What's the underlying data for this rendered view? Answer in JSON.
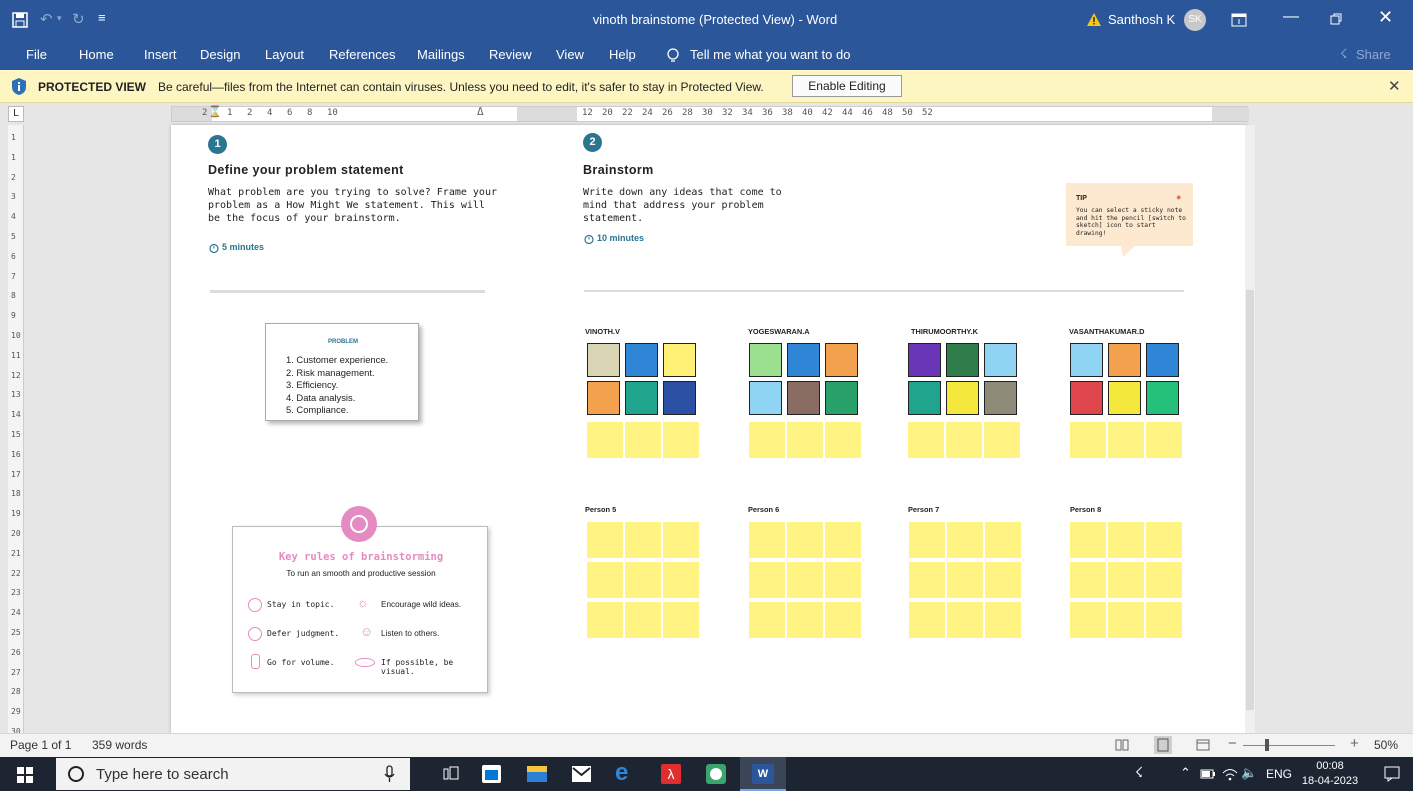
{
  "window": {
    "title": "vinoth brainstome (Protected View) - Word",
    "user": "Santhosh K",
    "user_initials": "SK"
  },
  "ribbon": {
    "tabs": [
      "File",
      "Home",
      "Insert",
      "Design",
      "Layout",
      "References",
      "Mailings",
      "Review",
      "View",
      "Help"
    ],
    "tell_me": "Tell me what you want to do",
    "share": "Share"
  },
  "protected_view": {
    "label": "PROTECTED VIEW",
    "message": "Be careful—files from the Internet can contain viruses. Unless you need to edit, it's safer to stay in Protected View.",
    "button": "Enable Editing"
  },
  "ruler": {
    "corner": "L",
    "numbers": [
      "2",
      "1",
      "2",
      "4",
      "6",
      "8",
      "10",
      "12",
      "20",
      "22",
      "24",
      "26",
      "28",
      "30",
      "32",
      "34",
      "36",
      "38",
      "40",
      "42",
      "44",
      "46",
      "48",
      "50",
      "52"
    ],
    "vnumbers": [
      "1",
      "1",
      "2",
      "3",
      "4",
      "5",
      "6",
      "7",
      "8",
      "9",
      "10",
      "11",
      "12",
      "13",
      "14",
      "15",
      "16",
      "17",
      "18",
      "19",
      "20",
      "21",
      "22",
      "23",
      "24",
      "25",
      "26",
      "27",
      "28",
      "29",
      "30"
    ]
  },
  "doc": {
    "step1": {
      "num": "1",
      "title": "Define your problem statement",
      "body": "What problem are you trying to solve? Frame your problem as a How Might We statement. This will be the focus of your brainstorm.",
      "time": "5 minutes"
    },
    "step2": {
      "num": "2",
      "title": "Brainstorm",
      "body": "Write down any ideas that come to mind that address your problem statement.",
      "time": "10 minutes"
    },
    "tip": {
      "label": "TIP",
      "text": "You can select a sticky note and hit the pencil [switch to sketch] icon to start drawing!"
    },
    "problem": {
      "heading": "PROBLEM",
      "items": [
        "1. Customer experience.",
        "2. Risk management.",
        "3. Efficiency.",
        "4. Data analysis.",
        "5. Compliance."
      ]
    },
    "rules": {
      "title": "Key rules of brainstorming",
      "subtitle": "To run an smooth and productive session",
      "items": [
        "Stay in topic.",
        "Encourage wild ideas.",
        "Defer judgment.",
        "Listen to others.",
        "Go for volume.",
        "If possible, be visual."
      ]
    },
    "people": [
      "VINOTH.V",
      "YOGESWARAN.A",
      "THIRUMOORTHY.K",
      "VASANTHAKUMAR.D",
      "Person 5",
      "Person 6",
      "Person 7",
      "Person 8"
    ],
    "sticky_colors": {
      "p1": [
        "#d8d4b4",
        "#2f86d6",
        "#fff176",
        "#f4a14d",
        "#1fa58e",
        "#2a4fa3"
      ],
      "p2": [
        "#9be08f",
        "#2f86d6",
        "#f4a14d",
        "#8fd4f2",
        "#8a6d62",
        "#28a06a"
      ],
      "p3": [
        "#6a36b8",
        "#2e7d4a",
        "#8fd4f2",
        "#1fa58e",
        "#f5e83c",
        "#8e8a78"
      ],
      "p4": [
        "#8fd4f2",
        "#f4a14d",
        "#2f86d6",
        "#e0474c",
        "#f5e83c",
        "#25c07a"
      ],
      "empty": "#fff382"
    }
  },
  "status": {
    "page": "Page 1 of 1",
    "words": "359 words",
    "zoom": "50%"
  },
  "taskbar": {
    "search_placeholder": "Type here to search",
    "lang": "ENG",
    "time": "00:08",
    "date": "18-04-2023"
  }
}
